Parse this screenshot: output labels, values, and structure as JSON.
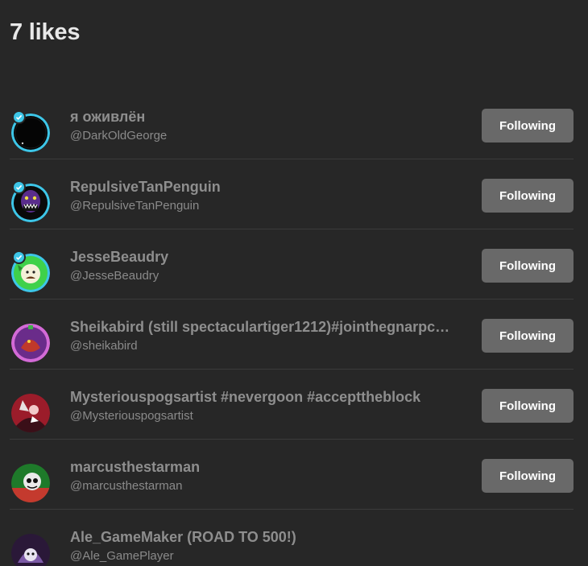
{
  "header": {
    "title": "7 likes"
  },
  "users": [
    {
      "display_name": "я оживлён",
      "handle": "@DarkOldGeorge",
      "follow_label": "Following",
      "avatar_icon": "avatar-dark-circle",
      "badge": true
    },
    {
      "display_name": "RepulsiveTanPenguin",
      "handle": "@RepulsiveTanPenguin",
      "follow_label": "Following",
      "avatar_icon": "avatar-purple-monster",
      "badge": true
    },
    {
      "display_name": "JesseBeaudry",
      "handle": "@JesseBeaudry",
      "follow_label": "Following",
      "avatar_icon": "avatar-green-cartoon",
      "badge": true
    },
    {
      "display_name": "Sheikabird (still spectaculartiger1212)#jointhegnarpc…",
      "handle": "@sheikabird",
      "follow_label": "Following",
      "avatar_icon": "avatar-purple-bird",
      "badge": false
    },
    {
      "display_name": "Mysteriouspogsartist #nevergoon #accepttheblock",
      "handle": "@Mysteriouspogsartist",
      "follow_label": "Following",
      "avatar_icon": "avatar-red-character",
      "badge": false
    },
    {
      "display_name": "marcusthestarman",
      "handle": "@marcusthestarman",
      "follow_label": "Following",
      "avatar_icon": "avatar-green-red-character",
      "badge": false
    },
    {
      "display_name": "Ale_GameMaker (ROAD TO 500!)",
      "handle": "@Ale_GamePlayer",
      "follow_label": "",
      "avatar_icon": "avatar-purple-dark-character",
      "badge": false
    }
  ],
  "colors": {
    "background": "#272727",
    "title": "#e8e8e8",
    "name_text": "#8e8e8e",
    "button_bg": "#696969",
    "button_text": "#ffffff",
    "badge": "#3dc6e8",
    "divider": "#3b3b3b"
  }
}
